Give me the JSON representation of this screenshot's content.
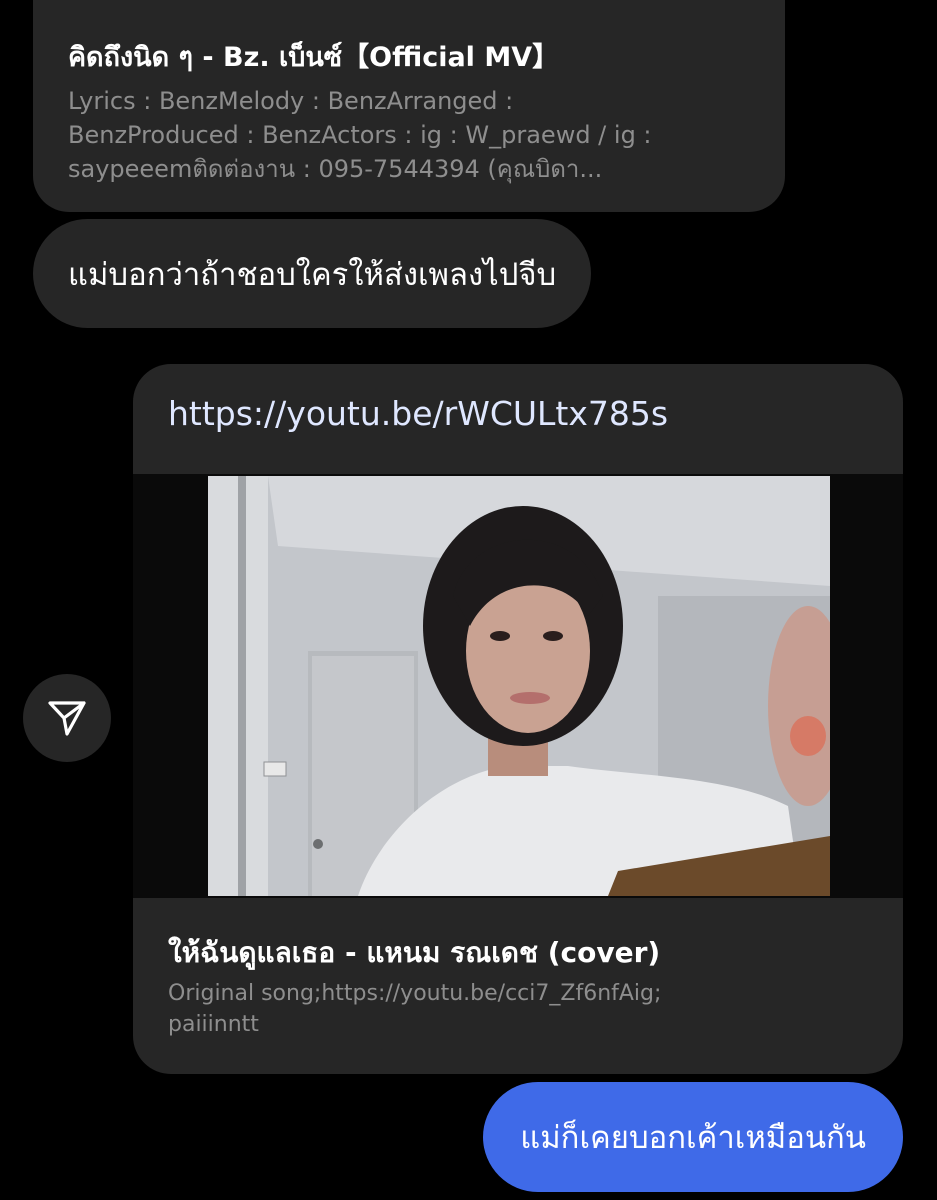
{
  "colors": {
    "background": "#000000",
    "bubble_incoming": "#262626",
    "bubble_outgoing": "#3f6ae8",
    "secondary_text": "#8e8e8e"
  },
  "messages": {
    "preview_top": {
      "title": "คิดถึงนิด ๆ - Bz. เบ็นซ์【Official MV】",
      "description_lines": [
        "Lyrics : BenzMelody : BenzArranged :",
        "BenzProduced : BenzActors : ig : W_praewd / ig :",
        "saypeeemติดต่องาน : 095-7544394 (คุณบิดา..."
      ]
    },
    "incoming_text": "แม่บอกว่าถ้าชอบใครให้ส่งเพลงไปจีบ",
    "link_card": {
      "url": "https://youtu.be/rWCULtx785s",
      "title": "ให้ฉันดูแลเธอ - แหนม รณเดช (cover)",
      "description_lines": [
        "Original song;https://youtu.be/cci7_Zf6nfAig;",
        "paiiinntt"
      ]
    },
    "outgoing_text": "แม่ก็เคยบอกเค้าเหมือนกัน"
  },
  "icons": {
    "share": "paper-plane-icon"
  }
}
